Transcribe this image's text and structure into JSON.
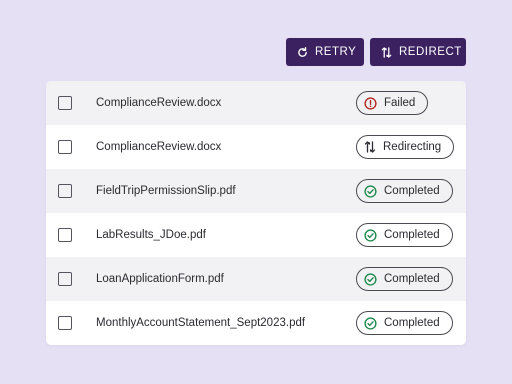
{
  "toolbar": {
    "retry_label": "RETRY",
    "redirect_label": "REDIRECT"
  },
  "rows": [
    {
      "filename": "ComplianceReview.docx",
      "status": "Failed",
      "status_icon": "error-icon"
    },
    {
      "filename": "ComplianceReview.docx",
      "status": "Redirecting",
      "status_icon": "redirect-icon"
    },
    {
      "filename": "FieldTripPermissionSlip.pdf",
      "status": "Completed",
      "status_icon": "check-circle-icon"
    },
    {
      "filename": "LabResults_JDoe.pdf",
      "status": "Completed",
      "status_icon": "check-circle-icon"
    },
    {
      "filename": "LoanApplicationForm.pdf",
      "status": "Completed",
      "status_icon": "check-circle-icon"
    },
    {
      "filename": "MonthlyAccountStatement_Sept2023.pdf",
      "status": "Completed",
      "status_icon": "check-circle-icon"
    }
  ],
  "colors": {
    "background": "#e6e0f5",
    "button": "#3b2160",
    "failed": "#b3261e",
    "completed": "#1f8a4c"
  }
}
